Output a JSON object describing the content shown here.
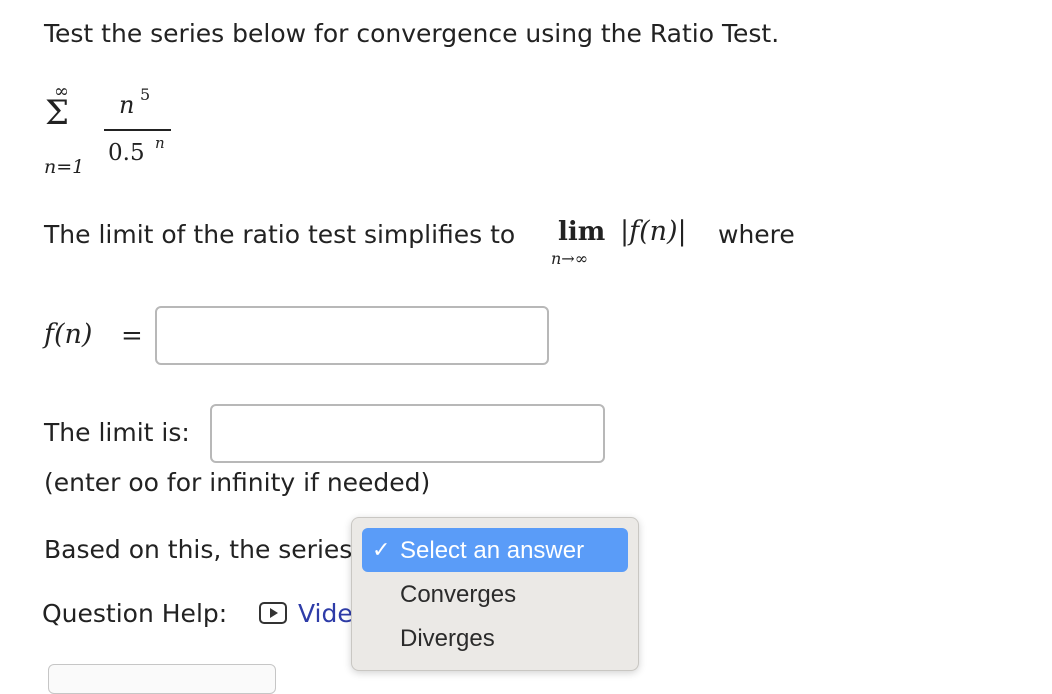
{
  "question": {
    "prompt": "Test the series below for convergence using the Ratio Test.",
    "series": {
      "sigma": "Σ",
      "upper": "∞",
      "lower": "n=1",
      "numerator_base": "n",
      "numerator_exp": "5",
      "denominator_base": "0.5",
      "denominator_exp": "n"
    },
    "limit_sentence_start": "The limit of the ratio test simplifies to",
    "lim_word": "lim",
    "lim_sub": "n→∞",
    "abs_expr": "|f(n)|",
    "limit_sentence_end": "where",
    "f_label": "f(n)",
    "equals": "=",
    "f_input_value": "",
    "limit_label": "The limit is:",
    "limit_input_value": "",
    "limit_hint": "(enter oo for infinity if needed)",
    "based_text": "Based on this, the series",
    "help_label": "Question Help:",
    "video_link": "Video"
  },
  "dropdown": {
    "selected_check": "✓",
    "options": [
      "Select an answer",
      "Converges",
      "Diverges"
    ],
    "selected_index": 0,
    "highlight_color": "#5a9cf8"
  },
  "colors": {
    "link": "#2e3ca8",
    "text": "#222222"
  }
}
